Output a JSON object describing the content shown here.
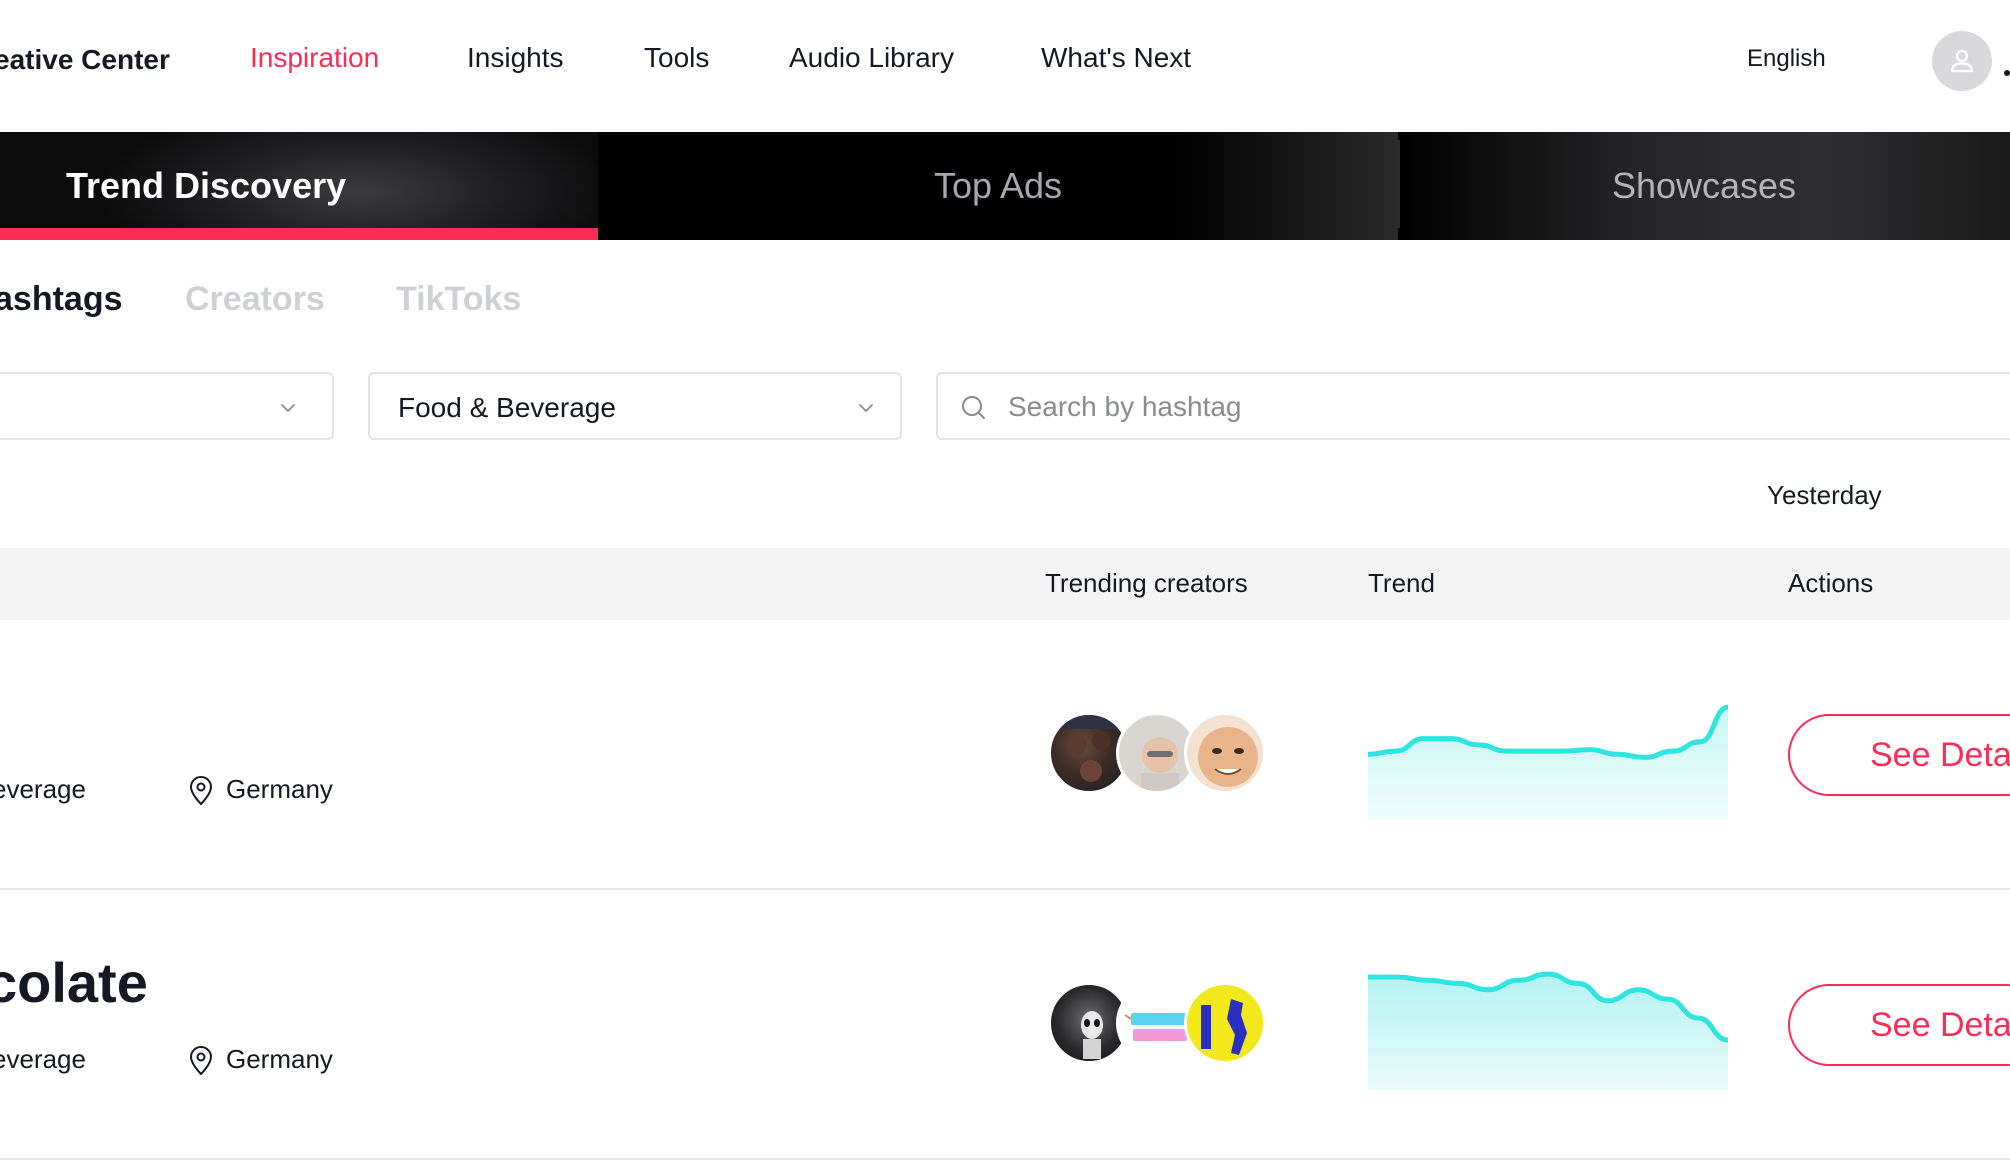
{
  "nav": {
    "brand": "eative Center",
    "links": [
      "Inspiration",
      "Insights",
      "Tools",
      "Audio Library",
      "What's Next"
    ],
    "active_link": "Inspiration",
    "language": "English",
    "accent": "#fe2c55"
  },
  "tabs": [
    "Trend Discovery",
    "Top Ads",
    "Showcases"
  ],
  "active_tab": "Trend Discovery",
  "subtabs": [
    "ashtags",
    "Creators",
    "TikToks"
  ],
  "active_subtab": "ashtags",
  "filters": {
    "first_select_value": "",
    "industry_select_value": "Food & Beverage",
    "search_placeholder": "Search by hashtag"
  },
  "period": "Yesterday",
  "table": {
    "headers": [
      "Trending creators",
      "Trend",
      "Actions"
    ],
    "rows": [
      {
        "title": "",
        "industry": "everage",
        "location": "Germany",
        "action_label": "See Deta",
        "trend": [
          0.7,
          0.72,
          0.8,
          0.8,
          0.76,
          0.72,
          0.72,
          0.72,
          0.73,
          0.7,
          0.68,
          0.72,
          0.78,
          1.0
        ]
      },
      {
        "title": "colate",
        "industry": "everage",
        "location": "Germany",
        "action_label": "See Deta",
        "trend": [
          1.0,
          1.0,
          0.98,
          0.96,
          0.92,
          0.98,
          1.02,
          0.96,
          0.85,
          0.92,
          0.86,
          0.74,
          0.6
        ]
      }
    ]
  },
  "icons": [
    "user-icon",
    "chevron-down-icon",
    "search-icon",
    "location-pin-icon"
  ]
}
